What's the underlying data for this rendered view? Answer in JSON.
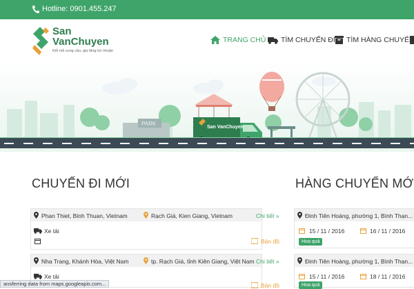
{
  "topbar": {
    "hotline": "Hotline: 0901.455.247"
  },
  "logo": {
    "line1": "San",
    "line2": "VanChuyen",
    "slogan": "Kết nối cung cầu, gia tăng lợi nhuận"
  },
  "nav": {
    "home": "TRANG CHỦ",
    "trips": "TÌM CHUYẾN ĐI",
    "cargo": "TÌM HÀNG CHUYỂN"
  },
  "banner": {
    "park_sign": "PARK",
    "truck_brand": "San VanChuyen"
  },
  "sections": {
    "trips_title": "CHUYẾN ĐI MỚI",
    "cargo_title": "HÀNG CHUYỂN MỚI"
  },
  "trips": [
    {
      "from": "Phan Thiet, Binh Thuan, Vietnam",
      "to": "Rạch Giá, Kien Giang, Vietnam",
      "detail": "Chi tiết",
      "vehicle": "Xe tải",
      "map": "Bản đồ"
    },
    {
      "from": "Nha Trang, Khánh Hòa, Việt Nam",
      "to": "tp. Rạch Giá, tỉnh Kiên Giang, Việt Nam",
      "detail": "Chi tiết",
      "vehicle": "Xe tải",
      "map": "Bản đồ"
    }
  ],
  "cargo": [
    {
      "address": "Đinh Tiên Hoàng, phường 1, Bình Thạn...",
      "date_from": "15 / 11 / 2016",
      "date_to": "16 / 11 / 2016",
      "tag": "Hoa quả"
    },
    {
      "address": "Đinh Tiên Hoàng, phường 1, Bình Thạn...",
      "date_from": "15 / 11 / 2016",
      "date_to": "18 / 11 / 2016",
      "tag": "Hoa quả"
    }
  ],
  "statusbar": {
    "text": "ansferring data from maps.googleapis.com..."
  },
  "colors": {
    "brand_green": "#3fa46a",
    "dark_green": "#2e7d4f",
    "map_orange": "#e8a13a",
    "road": "#3b4a55"
  },
  "icons": [
    "phone-icon",
    "home-icon",
    "truck-icon",
    "box-icon",
    "map-pin-icon",
    "calendar-icon",
    "map-icon"
  ]
}
